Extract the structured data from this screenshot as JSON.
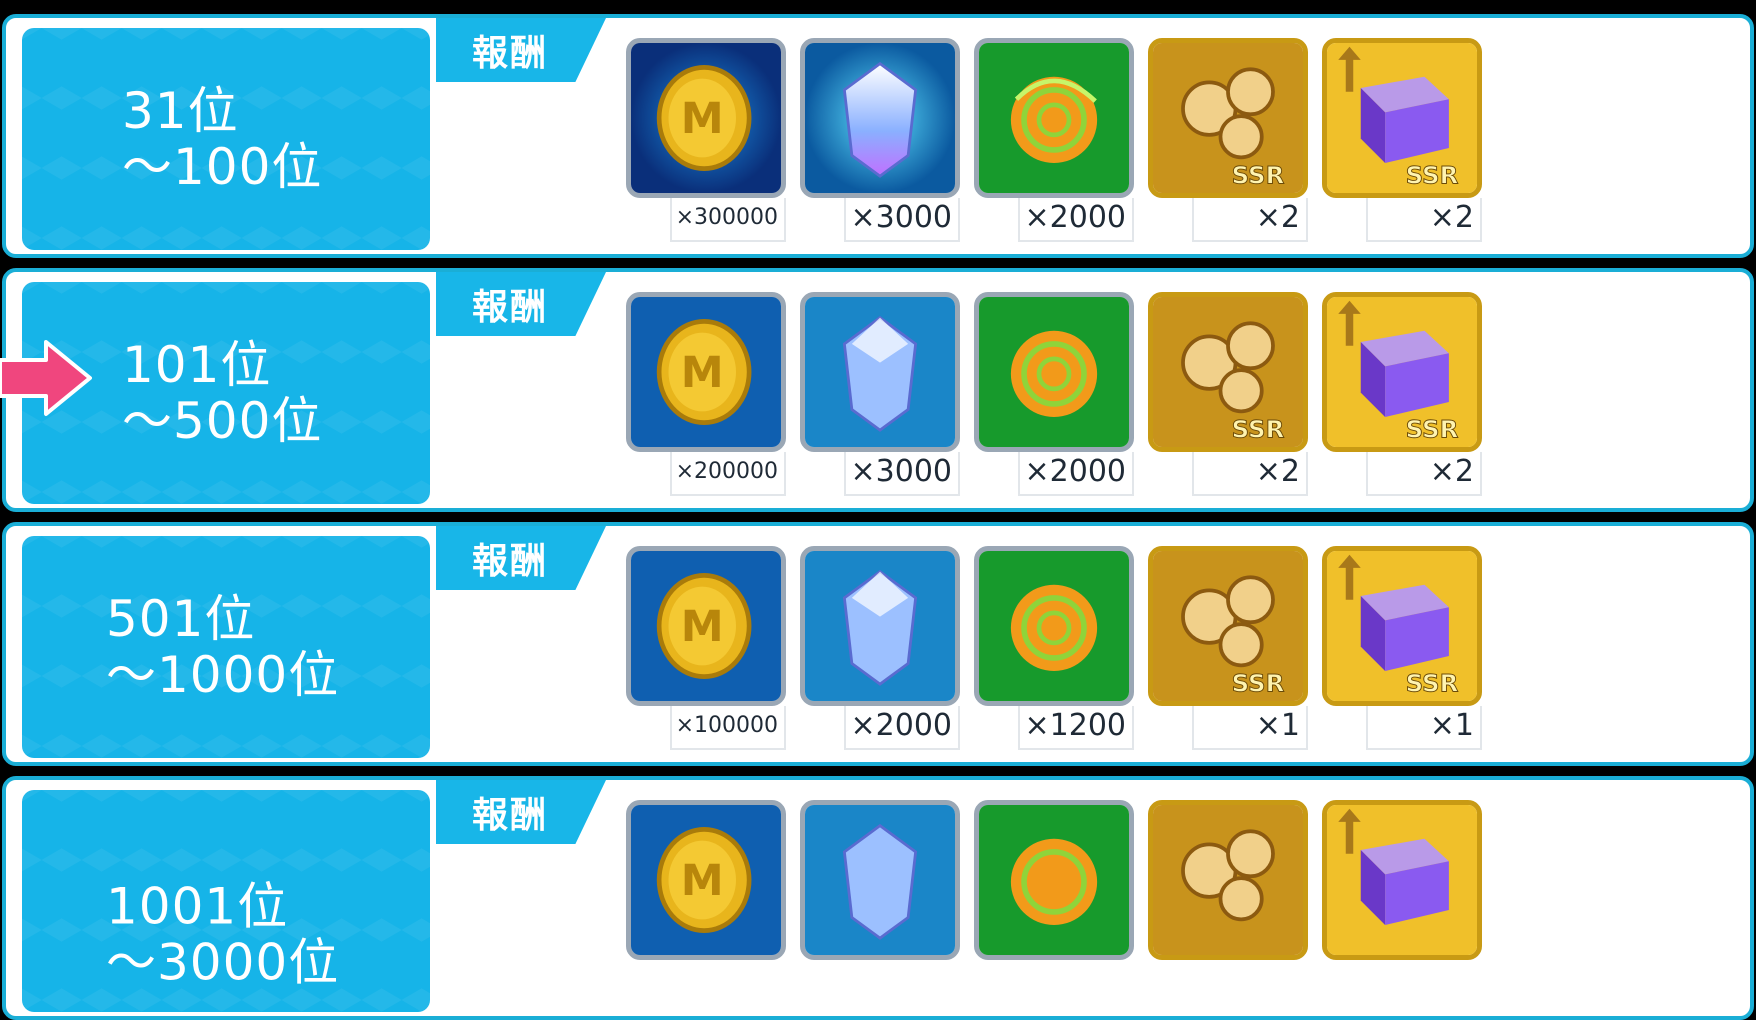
{
  "reward_label": "報酬",
  "rows": [
    {
      "rank_line1": "31位",
      "rank_line2": "～100位",
      "quantities": [
        "×300000",
        "×3000",
        "×2000",
        "×2",
        "×2"
      ]
    },
    {
      "rank_line1": "101位",
      "rank_line2": "～500位",
      "quantities": [
        "×200000",
        "×3000",
        "×2000",
        "×2",
        "×2"
      ]
    },
    {
      "rank_line1": "501位",
      "rank_line2": "～1000位",
      "quantities": [
        "×100000",
        "×2000",
        "×1200",
        "×1",
        "×1"
      ]
    },
    {
      "rank_line1": "1001位",
      "rank_line2": "～3000位",
      "quantities": [
        "",
        "",
        "",
        "",
        ""
      ]
    }
  ],
  "items": [
    {
      "icon": "coin-icon"
    },
    {
      "icon": "crystal-icon"
    },
    {
      "icon": "green-disc-icon"
    },
    {
      "icon": "ssr-ticket-icon",
      "badge": "SSR"
    },
    {
      "icon": "ssr-upgrade-cube-icon",
      "badge": "SSR"
    }
  ],
  "current_row_index": 1,
  "colors": {
    "accent": "#16b4e8",
    "frame": "#1aaed6",
    "arrow": "#f0467e"
  }
}
